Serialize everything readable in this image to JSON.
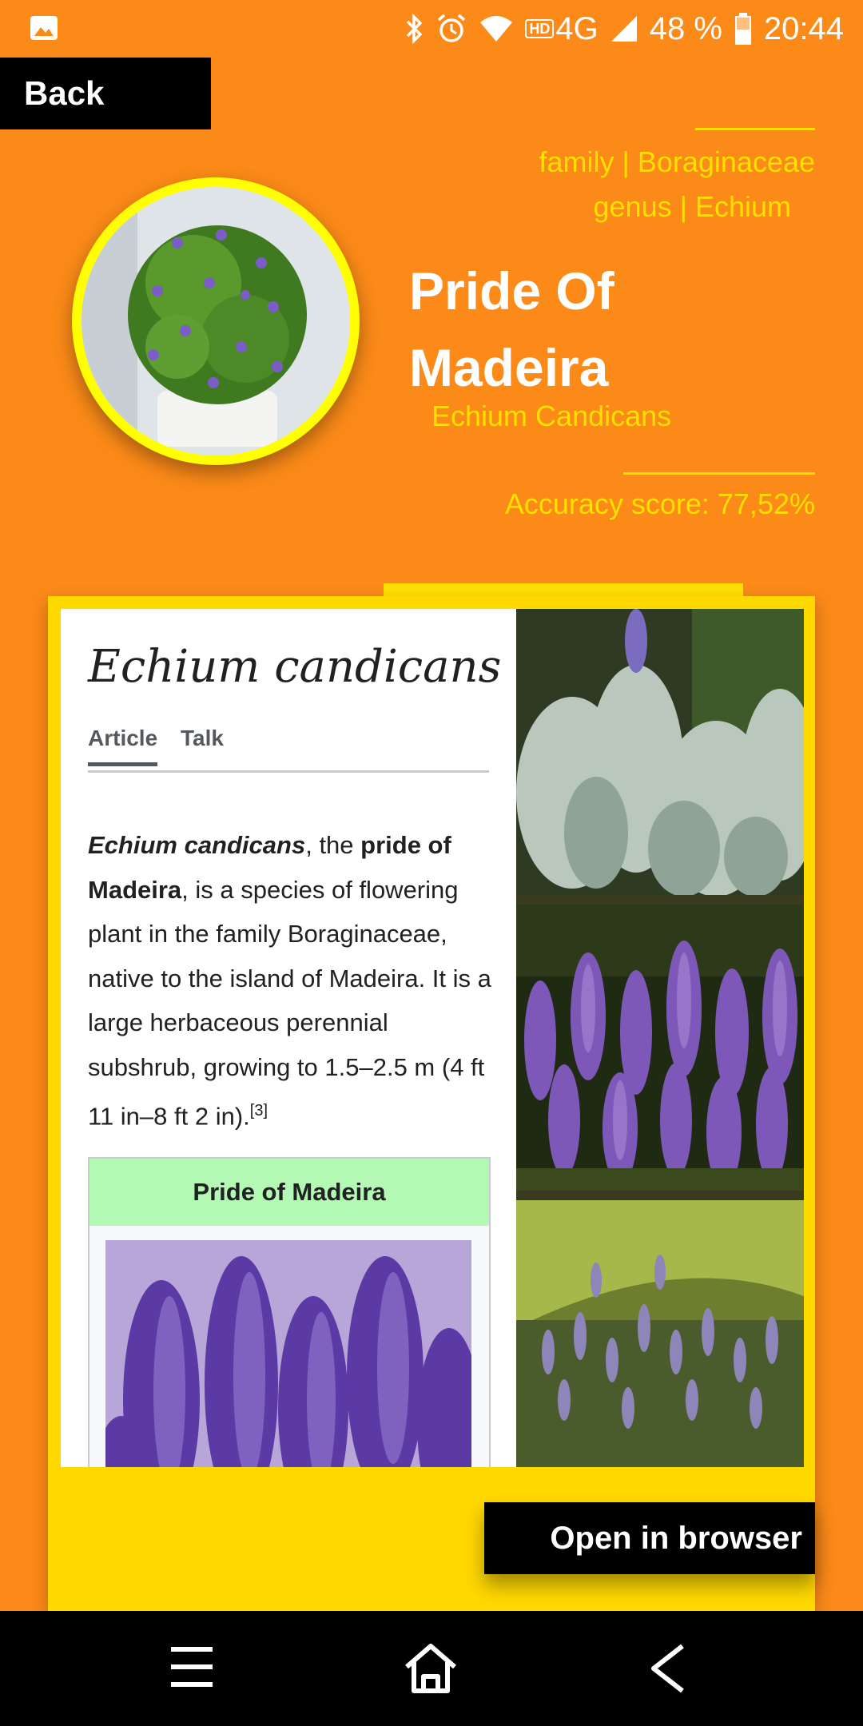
{
  "status_bar": {
    "network": "4G",
    "hd_badge": "HD",
    "battery": "48 %",
    "time": "20:44"
  },
  "back_label": "Back",
  "taxonomy": {
    "family": "family | Boraginaceae",
    "genus": "genus | Echium"
  },
  "plant": {
    "common_name": "Pride Of Madeira",
    "scientific_name": "Echium Candicans",
    "accuracy": "Accuracy score: 77,52%"
  },
  "wiki": {
    "title": "Echium candicans",
    "tabs": [
      "Article",
      "Talk"
    ],
    "intro": {
      "sci_name": "Echium candicans",
      "text_1": ", the ",
      "common_bold": "pride of Madeira",
      "text_2": ", is a species of flowering plant in the family Boraginaceae, native to the island of Madeira. It is a large herbaceous perennial subshrub, growing to 1.5–2.5 m (4 ft 11 in–8 ft 2 in).",
      "ref": "[3]"
    },
    "infobox_title": "Pride of Madeira"
  },
  "open_browser_label": "Open in browser",
  "colors": {
    "background": "#fb8a18",
    "accent_yellow": "#ffe000",
    "card_yellow": "#ffd800",
    "infobox_green": "#b3f9b3"
  },
  "icons": [
    "image-notification-icon",
    "bluetooth-icon",
    "alarm-icon",
    "wifi-icon",
    "signal-icon",
    "battery-icon",
    "menu-icon",
    "home-icon",
    "back-icon"
  ]
}
